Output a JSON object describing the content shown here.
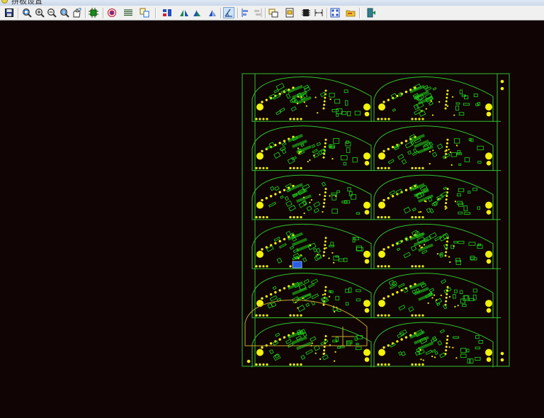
{
  "window": {
    "title": "拼板设置"
  },
  "toolbar": {
    "buttons": [
      {
        "id": "save",
        "icon": "save-icon"
      },
      {
        "id": "zoom-fit",
        "icon": "zoom-fit-icon"
      },
      {
        "id": "zoom-in",
        "icon": "zoom-in-icon"
      },
      {
        "id": "zoom-out",
        "icon": "zoom-out-icon"
      },
      {
        "id": "zoom-window",
        "icon": "zoom-window-icon"
      },
      {
        "id": "pan",
        "icon": "pan-icon"
      },
      {
        "id": "board",
        "icon": "board-icon"
      },
      {
        "id": "target",
        "icon": "target-icon"
      },
      {
        "id": "layers",
        "icon": "layers-icon"
      },
      {
        "id": "copy",
        "icon": "copy-icon"
      },
      {
        "id": "array",
        "icon": "array-icon"
      },
      {
        "id": "mirror-h",
        "icon": "mirror-horizontal-icon"
      },
      {
        "id": "mirror-v",
        "icon": "mirror-vertical-icon"
      },
      {
        "id": "rotate",
        "icon": "rotate-icon"
      },
      {
        "id": "measure",
        "icon": "measure-icon",
        "active": true
      },
      {
        "id": "align-left",
        "icon": "align-left-icon"
      },
      {
        "id": "align-disabled",
        "icon": "align-right-icon"
      },
      {
        "id": "route",
        "icon": "route-icon"
      },
      {
        "id": "import",
        "icon": "import-icon"
      },
      {
        "id": "fiducial",
        "icon": "fiducial-icon"
      },
      {
        "id": "dimension",
        "icon": "dimension-icon"
      },
      {
        "id": "grid",
        "icon": "grid-icon"
      },
      {
        "id": "open",
        "icon": "open-folder-icon"
      },
      {
        "id": "exit",
        "icon": "exit-icon"
      }
    ]
  },
  "panel": {
    "rows": 6,
    "columns": 2,
    "colors": {
      "background": "#100404",
      "outline": "#2fc22f",
      "pad": "#f2f20a",
      "silkscreen": "#1ed81e",
      "selection": "#c8a830",
      "marker": "#2a5ee8"
    }
  }
}
